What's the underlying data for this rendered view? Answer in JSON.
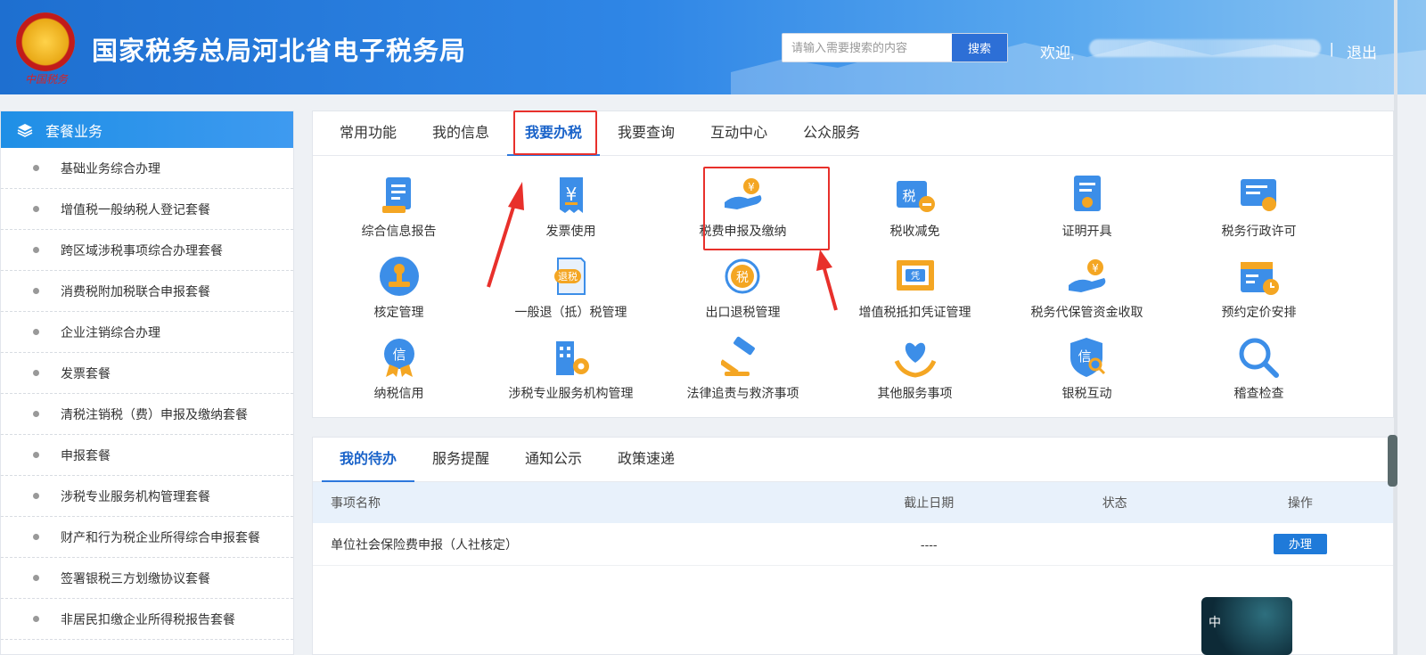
{
  "header": {
    "emblem_text": "中国税务",
    "title": "国家税务总局河北省电子税务局",
    "search_placeholder": "请输入需要搜索的内容",
    "search_button": "搜索",
    "welcome": "欢迎,",
    "separator": "|",
    "logout": "退出"
  },
  "sidebar": {
    "title": "套餐业务",
    "items": [
      "基础业务综合办理",
      "增值税一般纳税人登记套餐",
      "跨区域涉税事项综合办理套餐",
      "消费税附加税联合申报套餐",
      "企业注销综合办理",
      "发票套餐",
      "清税注销税（费）申报及缴纳套餐",
      "申报套餐",
      "涉税专业服务机构管理套餐",
      "财产和行为税企业所得综合申报套餐",
      "签署银税三方划缴协议套餐",
      "非居民扣缴企业所得税报告套餐"
    ]
  },
  "main_tabs": [
    "常用功能",
    "我的信息",
    "我要办税",
    "我要查询",
    "互动中心",
    "公众服务"
  ],
  "main_tabs_active": "我要办税",
  "services": [
    {
      "label": "综合信息报告",
      "icon": "report-icon"
    },
    {
      "label": "发票使用",
      "icon": "invoice-icon"
    },
    {
      "label": "税费申报及缴纳",
      "icon": "tax-payment-icon"
    },
    {
      "label": "税收减免",
      "icon": "tax-reduction-icon"
    },
    {
      "label": "证明开具",
      "icon": "certificate-icon"
    },
    {
      "label": "税务行政许可",
      "icon": "license-icon"
    },
    {
      "label": "核定管理",
      "icon": "stamp-icon"
    },
    {
      "label": "一般退（抵）税管理",
      "icon": "refund-icon"
    },
    {
      "label": "出口退税管理",
      "icon": "export-refund-icon"
    },
    {
      "label": "增值税抵扣凭证管理",
      "icon": "voucher-icon"
    },
    {
      "label": "税务代保管资金收取",
      "icon": "custody-fund-icon"
    },
    {
      "label": "预约定价安排",
      "icon": "calendar-icon"
    },
    {
      "label": "纳税信用",
      "icon": "credit-medal-icon"
    },
    {
      "label": "涉税专业服务机构管理",
      "icon": "building-gear-icon"
    },
    {
      "label": "法律追责与救济事项",
      "icon": "gavel-icon"
    },
    {
      "label": "其他服务事项",
      "icon": "heart-hands-icon"
    },
    {
      "label": "银税互动",
      "icon": "bank-shield-icon"
    },
    {
      "label": "稽查检查",
      "icon": "magnifier-icon"
    }
  ],
  "todo": {
    "tabs": [
      "我的待办",
      "服务提醒",
      "通知公示",
      "政策速递"
    ],
    "active_tab": "我的待办",
    "columns": [
      "事项名称",
      "截止日期",
      "状态",
      "操作"
    ],
    "rows": [
      {
        "name": "单位社会保险费申报（人社核定）",
        "deadline": "----",
        "status": "",
        "action": "办理"
      }
    ]
  },
  "thumbnail_char": "中",
  "colors": {
    "brand_blue": "#2d78dc",
    "highlight_red": "#e8302b",
    "icon_blue": "#3c8ee8",
    "icon_orange": "#f4a623"
  }
}
